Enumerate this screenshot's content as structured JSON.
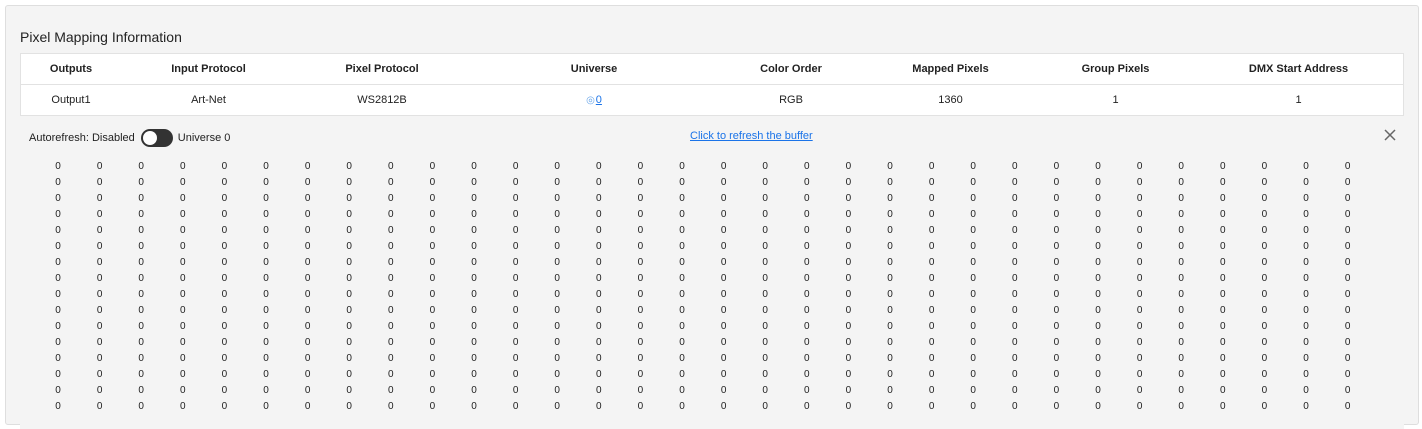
{
  "panel": {
    "title": "Pixel Mapping Information"
  },
  "table": {
    "headers": [
      "Outputs",
      "Input Protocol",
      "Pixel Protocol",
      "Universe",
      "Color Order",
      "Mapped Pixels",
      "Group Pixels",
      "DMX Start Address"
    ],
    "rows": [
      {
        "output": "Output1",
        "input_protocol": "Art-Net",
        "pixel_protocol": "WS2812B",
        "universe": "0",
        "color_order": "RGB",
        "mapped_pixels": "1360",
        "group_pixels": "1",
        "dmx_start_address": "1"
      }
    ]
  },
  "buffer": {
    "autorefresh_label": "Autorefresh: Disabled",
    "autorefresh_on": false,
    "universe_label": "Universe 0",
    "refresh_link": "Click to refresh the buffer",
    "value": "0",
    "columns": 32,
    "rows": 16
  }
}
